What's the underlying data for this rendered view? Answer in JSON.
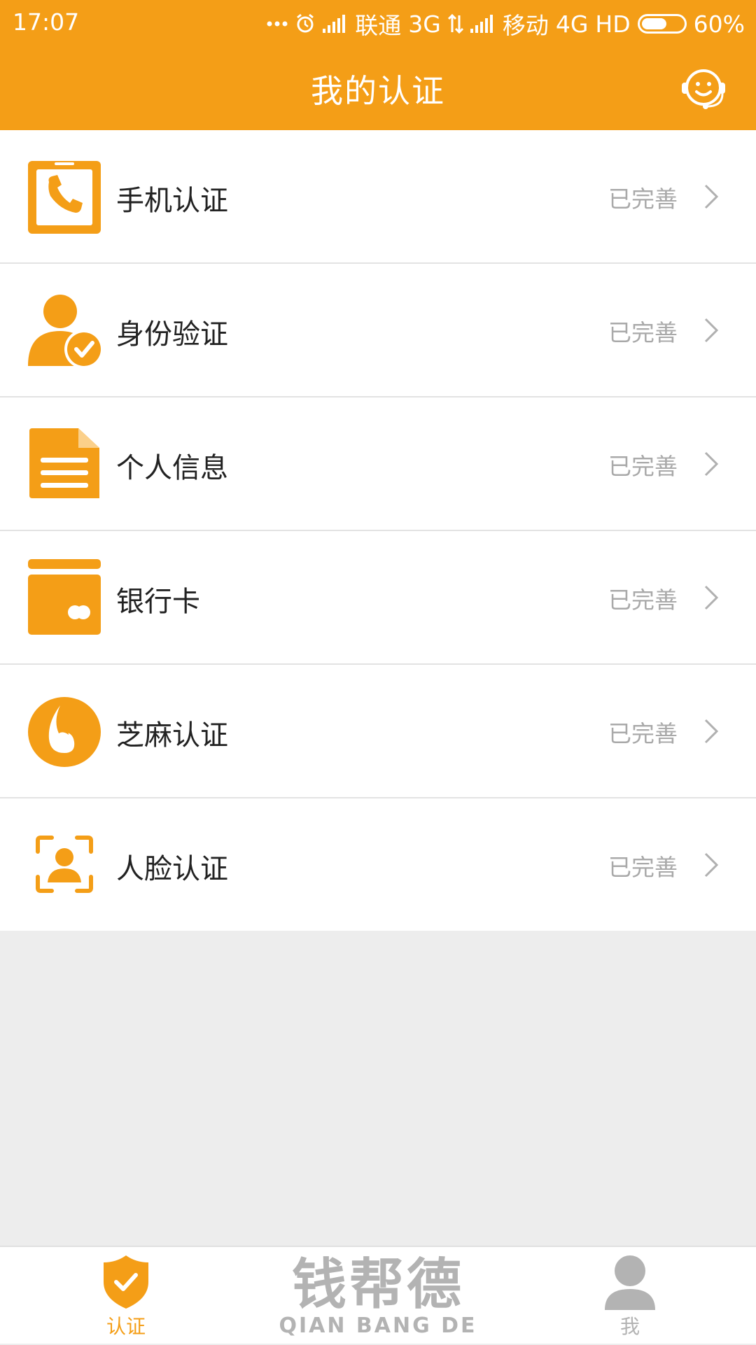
{
  "status_bar": {
    "time": "17:07",
    "carrier1": "联通",
    "network1": "3G",
    "carrier2": "移动",
    "network2": "4G",
    "hd": "HD",
    "battery": "60%",
    "battery_level": 0.6
  },
  "header": {
    "title": "我的认证",
    "support_icon": "headset-smile-icon"
  },
  "items": [
    {
      "label": "手机认证",
      "status": "已完善",
      "icon": "phone-icon"
    },
    {
      "label": "身份验证",
      "status": "已完善",
      "icon": "user-check-icon"
    },
    {
      "label": "个人信息",
      "status": "已完善",
      "icon": "document-icon"
    },
    {
      "label": "银行卡",
      "status": "已完善",
      "icon": "bank-card-icon"
    },
    {
      "label": "芝麻认证",
      "status": "已完善",
      "icon": "sesame-icon"
    },
    {
      "label": "人脸认证",
      "status": "已完善",
      "icon": "face-scan-icon"
    }
  ],
  "tabbar": {
    "tabs": [
      {
        "label": "认证",
        "icon": "shield-check-icon",
        "active": true
      },
      {
        "label": "我",
        "icon": "person-icon",
        "active": false
      }
    ],
    "brand_cn": "钱帮德",
    "brand_en": "QIAN BANG DE"
  },
  "colors": {
    "accent": "#f49e17",
    "inactive": "#b3b3b3",
    "status_text": "#a9a9a9"
  }
}
